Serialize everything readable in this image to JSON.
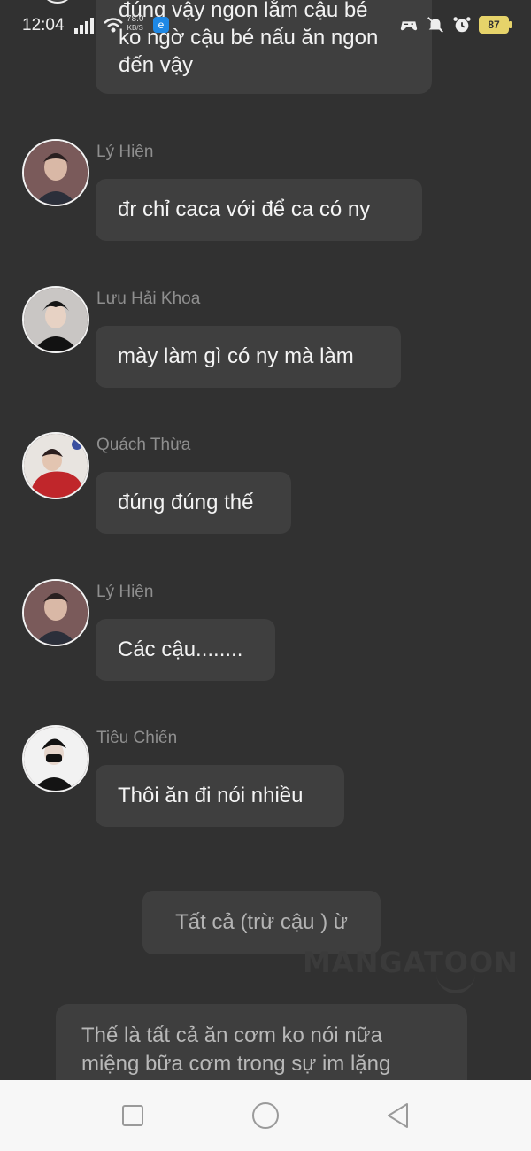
{
  "status_bar": {
    "time": "12:04",
    "net_speed_value": "78.0",
    "net_speed_unit": "KB/S",
    "battery": "87",
    "app_badge": "e",
    "icons": [
      "signal-icon",
      "wifi-icon",
      "browser-app-icon",
      "game-icon",
      "mute-icon",
      "alarm-icon",
      "battery-icon"
    ]
  },
  "top_message": {
    "lines": [
      "đúng vậy ngon lắm cậu bé",
      "ko ngờ cậu bé nấu ăn ngon",
      "đến vậy"
    ]
  },
  "messages": [
    {
      "sender": "Lý Hiện",
      "text": "đr chỉ caca với để ca  có ny"
    },
    {
      "sender": "Lưu Hải Khoa",
      "text": "mày làm gì có ny mà làm"
    },
    {
      "sender": "Quách Thừa",
      "text": "đúng đúng thế"
    },
    {
      "sender": "Lý Hiện",
      "text": "Các cậu........"
    },
    {
      "sender": "Tiêu Chiến",
      "text": "Thôi ăn đi nói nhiều"
    }
  ],
  "center_message": "Tất cả (trừ cậu ) ừ",
  "watermark": "MANGATOON",
  "narration": {
    "lines": [
      "Thế là tất cả ăn cơm ko nói nữa",
      "miệng bữa cơm trong sự im lặng"
    ]
  },
  "nav_bar": {
    "buttons": [
      "recent-apps-button",
      "home-button",
      "back-button"
    ]
  },
  "colors": {
    "background": "#313131",
    "bubble": "#3f3f3f",
    "sender_name": "#8f8f8f",
    "battery": "#e6d36a",
    "nav_bar": "#f7f7f7"
  }
}
